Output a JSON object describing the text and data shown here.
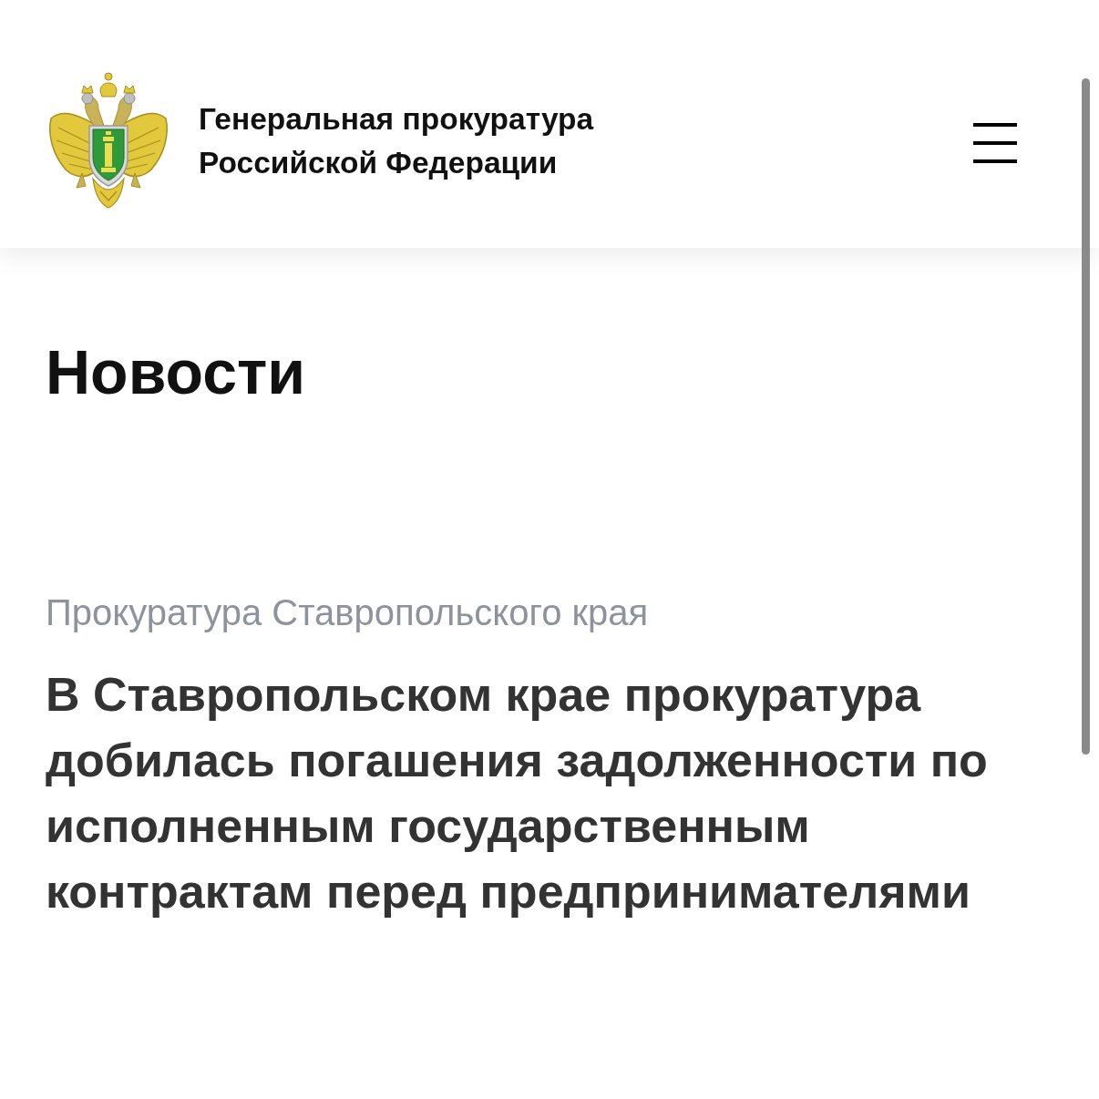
{
  "header": {
    "title": "Генеральная прокуратура Российской Федерации"
  },
  "page": {
    "heading": "Новости"
  },
  "news": [
    {
      "source": "Прокуратура Ставропольского края",
      "headline": "В Ставропольском крае прокуратура добилась погашения задолженности по исполненным государственным контрактам перед предпринимателями"
    }
  ]
}
